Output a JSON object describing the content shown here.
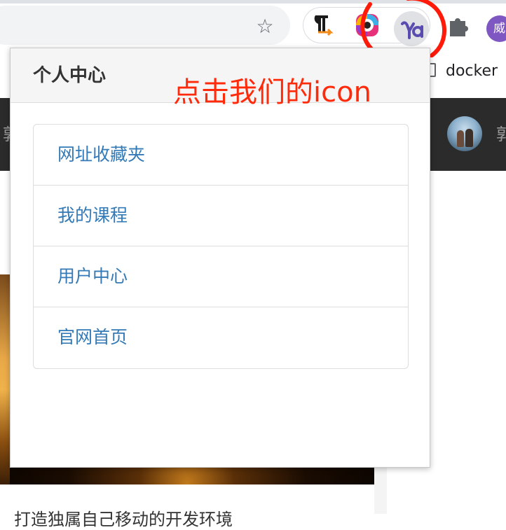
{
  "browser": {
    "avatar_text": "威",
    "bookmark_label": "docker",
    "icons": [
      "star-icon",
      "pilcrow-icon",
      "rainbow-ring-icon",
      "fa-extension-icon",
      "puzzle-icon"
    ]
  },
  "background_page": {
    "nav_left_char": "郭",
    "nav_right_char": "郭",
    "bottom_text": "打造独属自己移动的开发环境"
  },
  "popup": {
    "title": "个人中心",
    "annotation": "点击我们的icon",
    "items": [
      {
        "label": "网址收藏夹"
      },
      {
        "label": "我的课程"
      },
      {
        "label": "用户中心"
      },
      {
        "label": "官网首页"
      }
    ]
  },
  "colors": {
    "link": "#337ab7",
    "annotation": "#ff2a0a",
    "nav_bg": "#2b2b2b"
  }
}
